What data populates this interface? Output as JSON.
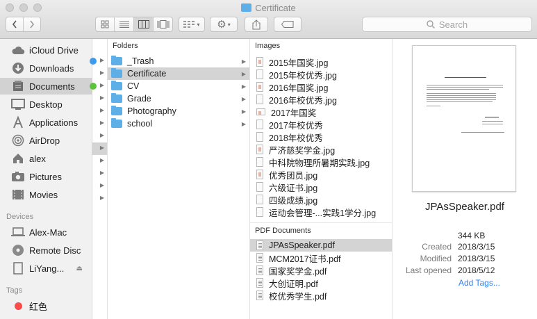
{
  "window": {
    "title": "Certificate"
  },
  "toolbar": {
    "search_placeholder": "Search"
  },
  "sidebar": {
    "favorites": [
      {
        "label": "iCloud Drive",
        "icon": "cloud-icon"
      },
      {
        "label": "Downloads",
        "icon": "download-icon"
      },
      {
        "label": "Documents",
        "icon": "documents-icon",
        "selected": true
      },
      {
        "label": "Desktop",
        "icon": "desktop-icon"
      },
      {
        "label": "Applications",
        "icon": "applications-icon"
      },
      {
        "label": "AirDrop",
        "icon": "airdrop-icon"
      },
      {
        "label": "alex",
        "icon": "home-icon"
      },
      {
        "label": "Pictures",
        "icon": "pictures-icon"
      },
      {
        "label": "Movies",
        "icon": "movies-icon"
      }
    ],
    "devices_header": "Devices",
    "devices": [
      {
        "label": "Alex-Mac",
        "icon": "laptop-icon"
      },
      {
        "label": "Remote Disc",
        "icon": "disc-icon"
      },
      {
        "label": "LiYang...",
        "icon": "drive-icon"
      }
    ],
    "tags_header": "Tags",
    "tags": [
      {
        "label": "红色",
        "color": "#fc4b48"
      }
    ]
  },
  "column0": {
    "dot_colors": [
      "#3d9bec",
      "#5cc33b"
    ]
  },
  "folders_column": {
    "header": "Folders",
    "items": [
      "_Trash",
      "Certificate",
      "CV",
      "Grade",
      "Photography",
      "school"
    ],
    "selected": "Certificate"
  },
  "files_column": {
    "images_header": "Images",
    "images": [
      "2015年国奖.jpg",
      "2015年校优秀.jpg",
      "2016年国奖.jpg",
      "2016年校优秀.jpg",
      "2017年国奖",
      "2017年校优秀",
      "2018年校优秀",
      "严济慈奖学金.jpg",
      "中科院物理所暑期实践.jpg",
      "优秀团员.jpg",
      "六级证书.jpg",
      "四级成绩.jpg",
      "运动会管理-...实践1学分.jpg"
    ],
    "pdf_header": "PDF Documents",
    "pdfs": [
      "JPAsSpeaker.pdf",
      "MCM2017证书.pdf",
      "国家奖学金.pdf",
      "大创证明.pdf",
      "校优秀学生.pdf"
    ],
    "selected": "JPAsSpeaker.pdf"
  },
  "preview": {
    "filename": "JPAsSpeaker.pdf",
    "size": "344 KB",
    "created_label": "Created",
    "created": "2018/3/15",
    "modified_label": "Modified",
    "modified": "2018/3/15",
    "opened_label": "Last opened",
    "opened": "2018/5/12",
    "add_tags": "Add Tags..."
  }
}
